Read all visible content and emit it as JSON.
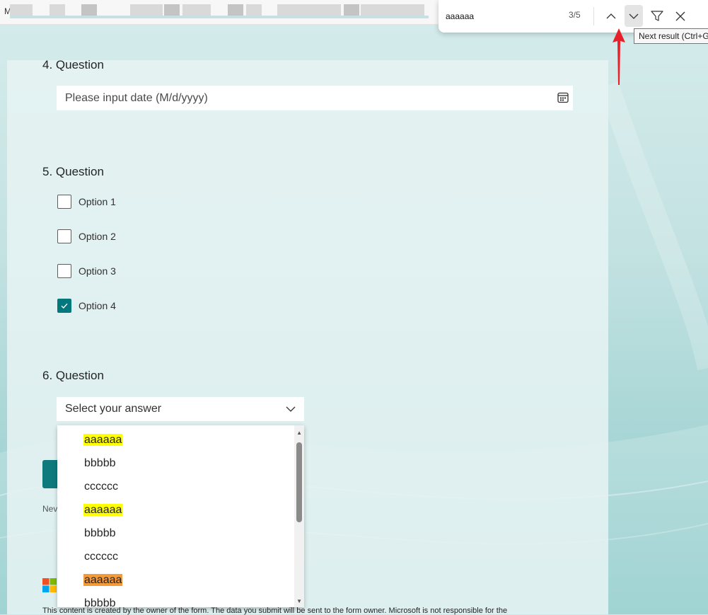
{
  "browser": {
    "tab_first_letter": "M"
  },
  "find_bar": {
    "query": "aaaaaa",
    "count": "3/5",
    "prev_icon": "chevron-up-icon",
    "next_icon": "chevron-down-icon",
    "filter_icon": "filter-icon",
    "close_icon": "close-icon",
    "tooltip": "Next result (Ctrl+G"
  },
  "form": {
    "q4": {
      "title": "4. Question",
      "placeholder": "Please input date (M/d/yyyy)",
      "icon": "calendar-icon"
    },
    "q5": {
      "title": "5. Question",
      "options": [
        {
          "label": "Option 1",
          "checked": false
        },
        {
          "label": "Option 2",
          "checked": false
        },
        {
          "label": "Option 3",
          "checked": false
        },
        {
          "label": "Option 4",
          "checked": true
        }
      ]
    },
    "q6": {
      "title": "6. Question",
      "placeholder": "Select your answer",
      "icon": "chevron-down-icon",
      "dropdown_items": [
        {
          "text": "aaaaaa",
          "highlight": "match"
        },
        {
          "text": "bbbbb",
          "highlight": "none"
        },
        {
          "text": "cccccc",
          "highlight": "none"
        },
        {
          "text": "aaaaaa",
          "highlight": "match"
        },
        {
          "text": "bbbbb",
          "highlight": "none"
        },
        {
          "text": "cccccc",
          "highlight": "none"
        },
        {
          "text": "aaaaaa",
          "highlight": "current"
        },
        {
          "text": "bbbbb",
          "highlight": "none"
        }
      ]
    },
    "submit_stub_text": "",
    "never_text": "Nev",
    "footer": "This content is created by the owner of the form. The data you submit will be sent to the form owner. Microsoft is not responsible for the"
  },
  "colors": {
    "accent": "#03787c",
    "match_highlight": "#ffff00",
    "current_highlight": "#f39a3a",
    "annotation_arrow": "#e8202a"
  }
}
